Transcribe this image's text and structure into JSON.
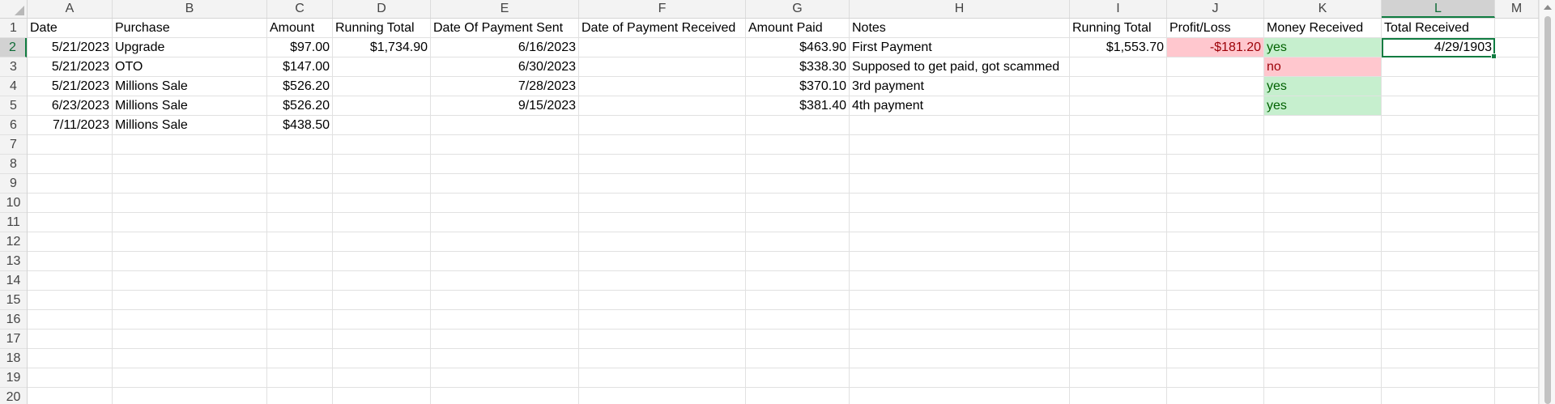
{
  "sheet": {
    "columns": [
      "A",
      "B",
      "C",
      "D",
      "E",
      "F",
      "G",
      "H",
      "I",
      "J",
      "K",
      "L",
      "M"
    ],
    "selected_column": "L",
    "row_numbers": [
      "1",
      "2",
      "3",
      "4",
      "5",
      "6",
      "7",
      "8",
      "9",
      "10",
      "11",
      "12",
      "13",
      "14",
      "15",
      "16",
      "17",
      "18",
      "19",
      "20"
    ],
    "selected_row": "2",
    "active_cell": "L2",
    "headers": {
      "A": "Date",
      "B": "Purchase",
      "C": "Amount",
      "D": "Running Total",
      "E": "Date Of Payment Sent",
      "F": "Date of Payment Received",
      "G": "Amount Paid",
      "H": "Notes",
      "I": "Running Total",
      "J": "Profit/Loss",
      "K": "Money Received",
      "L": "Total Received",
      "M": ""
    },
    "rows": [
      {
        "A": "5/21/2023",
        "B": "Upgrade",
        "C": "$97.00",
        "D": "$1,734.90",
        "E": "6/16/2023",
        "F": "",
        "G": "$463.90",
        "H": "First Payment",
        "I": "$1,553.70",
        "J": "-$181.20",
        "K": "yes",
        "L": "4/29/1903",
        "M": ""
      },
      {
        "A": "5/21/2023",
        "B": "OTO",
        "C": "$147.00",
        "D": "",
        "E": "6/30/2023",
        "F": "",
        "G": "$338.30",
        "H": "Supposed to get paid, got scammed",
        "I": "",
        "J": "",
        "K": "no",
        "L": "",
        "M": ""
      },
      {
        "A": "5/21/2023",
        "B": "Millions Sale",
        "C": "$526.20",
        "D": "",
        "E": "7/28/2023",
        "F": "",
        "G": "$370.10",
        "H": "3rd payment",
        "I": "",
        "J": "",
        "K": "yes",
        "L": "",
        "M": ""
      },
      {
        "A": "6/23/2023",
        "B": "Millions Sale",
        "C": "$526.20",
        "D": "",
        "E": "9/15/2023",
        "F": "",
        "G": "$381.40",
        "H": "4th payment",
        "I": "",
        "J": "",
        "K": "yes",
        "L": "",
        "M": ""
      },
      {
        "A": "7/11/2023",
        "B": "Millions Sale",
        "C": "$438.50",
        "D": "",
        "E": "",
        "F": "",
        "G": "",
        "H": "",
        "I": "",
        "J": "",
        "K": "",
        "L": "",
        "M": ""
      }
    ],
    "colors": {
      "header_bg": "#f3f3f3",
      "selection_accent": "#107c41",
      "bad_fill": "#ffc7ce",
      "bad_text": "#9c0006",
      "good_fill": "#c6efce",
      "good_text": "#006100"
    },
    "icons": {
      "select_all": "select-all-triangle-icon",
      "scroll_up": "scroll-up-arrow-icon"
    }
  }
}
